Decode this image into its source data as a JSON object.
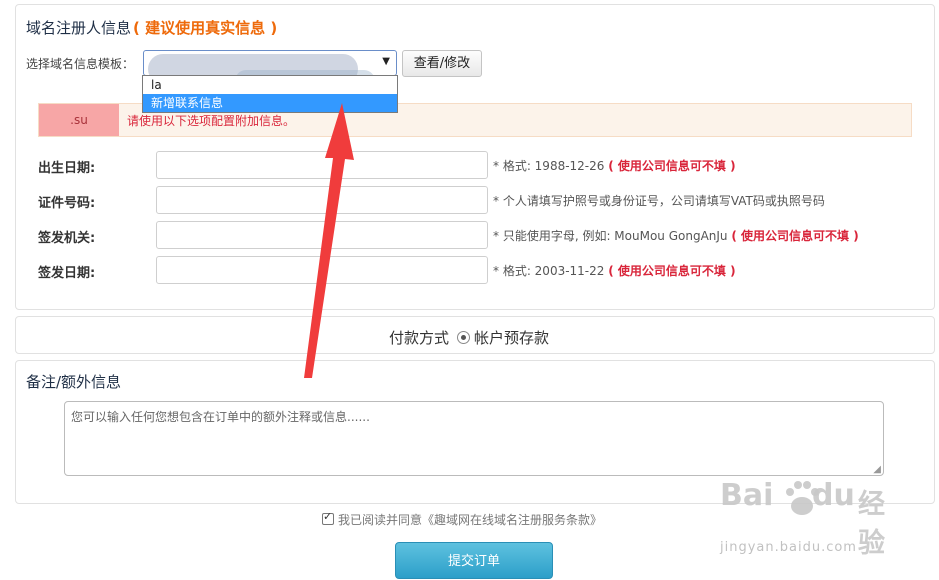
{
  "registrant": {
    "title": "域名注册人信息",
    "title_hint": "( 建议使用真实信息 )",
    "template_label": "选择域名信息模板：",
    "template_selected": "",
    "template_options": [
      "la",
      "新增联系信息"
    ],
    "view_button": "查看/修改"
  },
  "alert": {
    "tag": ".su",
    "message": "请使用以下选项配置附加信息。"
  },
  "fields": [
    {
      "label": "出生日期:",
      "hint": "* 格式: 1988-12-26",
      "hint_red": "( 使用公司信息可不填 )"
    },
    {
      "label": "证件号码:",
      "hint": "* 个人请填写护照号或身份证号，公司请填写VAT码或执照号码",
      "hint_red": ""
    },
    {
      "label": "签发机关:",
      "hint": "* 只能使用字母, 例如: MouMou GongAnJu",
      "hint_red": "( 使用公司信息可不填 )"
    },
    {
      "label": "签发日期:",
      "hint": "* 格式: 2003-11-22",
      "hint_red": "( 使用公司信息可不填 )"
    }
  ],
  "payment": {
    "label": "付款方式",
    "option": "帐户预存款"
  },
  "notes": {
    "title": "备注/额外信息",
    "placeholder": "您可以输入任何您想包含在订单中的额外注释或信息......"
  },
  "agreement": {
    "text": "我已阅读并同意《趣域网在线域名注册服务条款》"
  },
  "submit_button": "提交订单",
  "watermark": {
    "logo_text": "Bai",
    "logo_suffix": "du",
    "jingyan": "经验",
    "url": "jingyan.baidu.com"
  },
  "colors": {
    "accent": "#ee6a0b",
    "alert_red": "#d9263b",
    "highlight": "#3399ff",
    "submit": "#2c9fc9",
    "arrow": "#f03c3c"
  }
}
